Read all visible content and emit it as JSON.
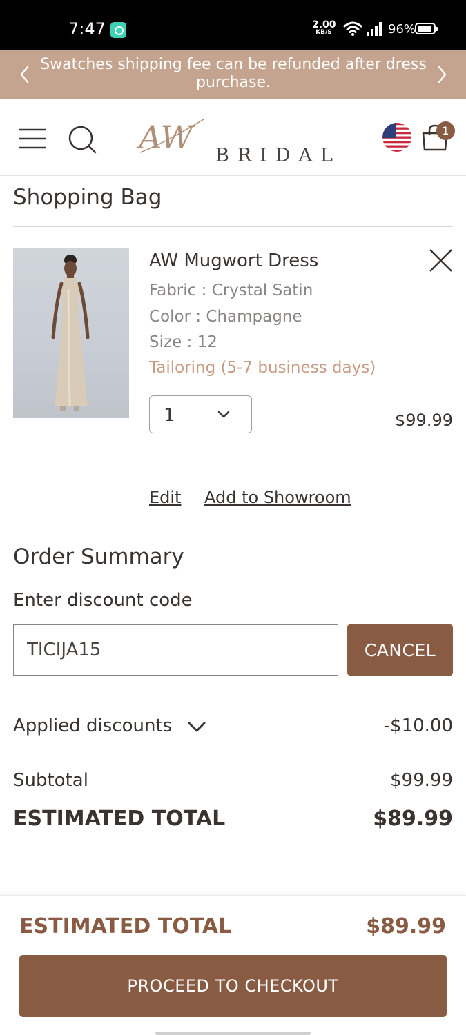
{
  "status_bar": {
    "time": "7:47",
    "net_speed": "2.00",
    "net_unit": "KB/S",
    "battery": "96%"
  },
  "promo": {
    "text": "Swatches shipping fee can be refunded after dress purchase."
  },
  "header": {
    "logo_monogram": "AW",
    "logo_text": "BRIDAL",
    "cart_count": "1",
    "icons": [
      "menu-icon",
      "search-icon",
      "us-flag-icon",
      "shopping-bag-icon"
    ]
  },
  "bag": {
    "title": "Shopping Bag",
    "item": {
      "name": "AW Mugwort Dress",
      "fabric": "Fabric : Crystal Satin",
      "color": "Color : Champagne",
      "size": "Size : 12",
      "tailoring": "Tailoring (5-7 business days)",
      "quantity": "1",
      "price": "$99.99"
    },
    "edit_label": "Edit",
    "showroom_label": "Add to Showroom"
  },
  "summary": {
    "title": "Order Summary",
    "discount_label": "Enter discount code",
    "discount_code": "TICIJA15",
    "cancel_label": "CANCEL",
    "applied_label": "Applied discounts",
    "applied_value": "-$10.00",
    "subtotal_label": "Subtotal",
    "subtotal_value": "$99.99",
    "estimated_label": "ESTIMATED TOTAL",
    "estimated_value": "$89.99"
  },
  "footer": {
    "estimated_label": "ESTIMATED TOTAL",
    "estimated_value": "$89.99",
    "checkout_label": "PROCEED TO CHECKOUT"
  },
  "colors": {
    "accent": "#8a5b43",
    "promo_bg": "#c4a48e",
    "tailoring": "#c89b84"
  }
}
